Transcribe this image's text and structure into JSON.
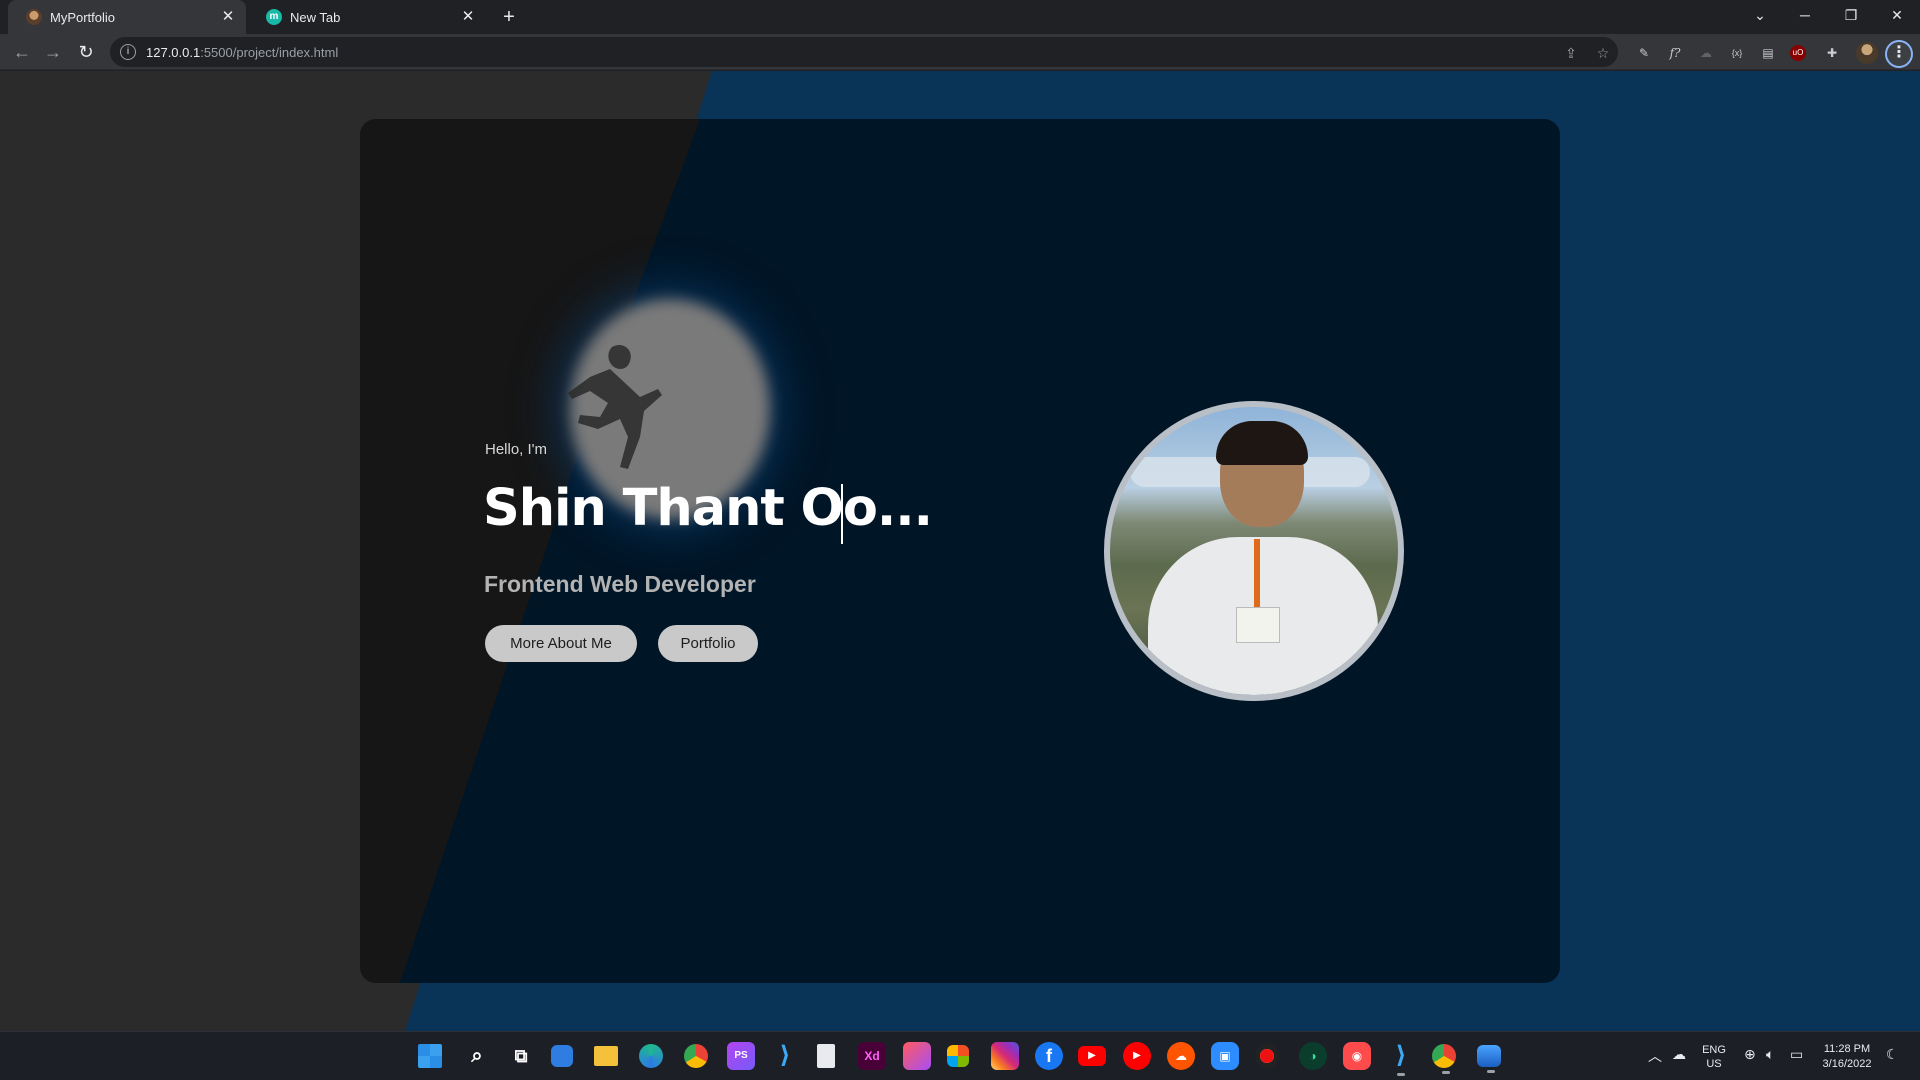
{
  "browser": {
    "tabs": [
      {
        "title": "MyPortfolio",
        "active": true
      },
      {
        "title": "New Tab",
        "active": false
      }
    ],
    "url_host": "127.0.0.1",
    "url_path": ":5500/project/index.html"
  },
  "hero": {
    "greeting": "Hello, I'm",
    "name": "Shin Thant Oo...",
    "role": "Frontend Web Developer",
    "buttons": {
      "about": "More About Me",
      "portfolio": "Portfolio"
    }
  },
  "colors": {
    "page_blue": "#0a3358",
    "card_bg": "#001526",
    "button_bg": "#c9c9c9"
  },
  "taskbar": {
    "apps": [
      "start-icon",
      "search-icon",
      "task-view-icon",
      "widgets-icon",
      "file-explorer-icon",
      "edge-icon",
      "chrome-icon",
      "phpstorm-icon",
      "vscode-icon",
      "notepad-icon",
      "adobe-xd-icon",
      "creative-cloud-icon",
      "store-icon",
      "instagram-icon",
      "facebook-icon",
      "youtube-icon",
      "youtube-music-icon",
      "soundcloud-icon",
      "zoom-icon",
      "record-icon",
      "clock-app-icon",
      "photo-app-icon",
      "vscode-icon",
      "chrome-icon",
      "photos-icon"
    ],
    "app_labels": {
      "xd": "Xd",
      "ps": "PS"
    },
    "language": "ENG",
    "region": "US",
    "time": "11:28 PM",
    "date": "3/16/2022"
  }
}
